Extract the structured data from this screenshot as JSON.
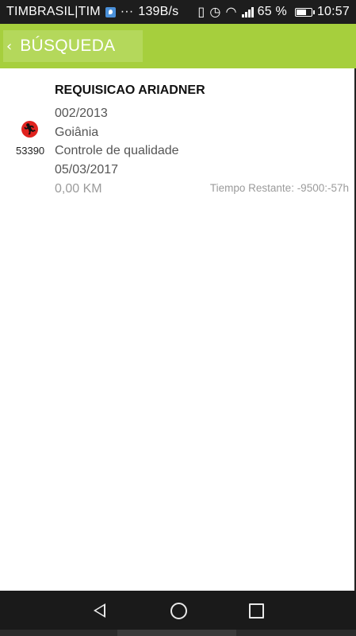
{
  "status_bar": {
    "carrier": "TIMBRASIL|TIM",
    "dots": "···",
    "speed": "139B/s",
    "battery_percent": "65 %",
    "time": "10:57",
    "icons": [
      "map-icon",
      "vibrate-icon",
      "alarm-icon",
      "wifi-icon",
      "signal-icon",
      "battery-icon"
    ]
  },
  "header": {
    "back_icon": "‹",
    "title": "BÚSQUEDA",
    "color": "#a6cf3d"
  },
  "item": {
    "title": "REQUISICAO ARIADNER",
    "number": "002/2013",
    "city": "Goiânia",
    "department": "Controle de qualidade",
    "date": "05/03/2017",
    "code": "53390",
    "distance": "0,00 KM",
    "time_remaining": "Tiempo Restante: -9500:-57h",
    "status_icon": "runner-icon",
    "status_color": "#e0231f"
  },
  "nav_bar": {
    "buttons": [
      "back-nav-icon",
      "home-nav-icon",
      "recents-nav-icon"
    ]
  }
}
